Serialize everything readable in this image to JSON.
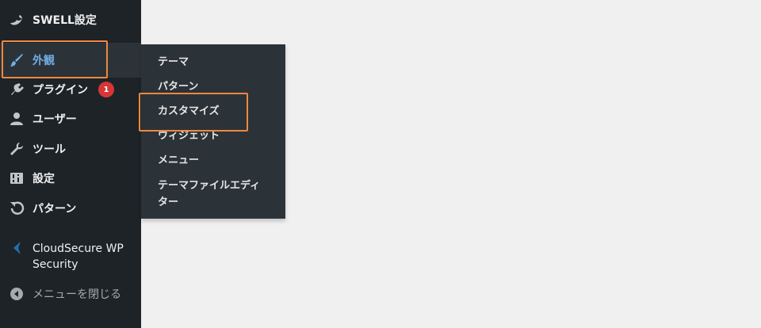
{
  "sidebar": {
    "items": [
      {
        "label": "SWELL設定",
        "icon": "swell-icon"
      },
      {
        "label": "外観",
        "icon": "paintbrush-icon"
      },
      {
        "label": "プラグイン",
        "icon": "plugin-icon",
        "badge": "1"
      },
      {
        "label": "ユーザー",
        "icon": "user-icon"
      },
      {
        "label": "ツール",
        "icon": "wrench-icon"
      },
      {
        "label": "設定",
        "icon": "settings-icon"
      },
      {
        "label": "パターン",
        "icon": "undo-icon"
      },
      {
        "label_line1": "CloudSecure WP",
        "label_line2": "Security",
        "icon": "cloudsecure-icon"
      },
      {
        "label": "メニューを閉じる",
        "icon": "collapse-icon"
      }
    ]
  },
  "submenu": {
    "items": [
      {
        "label": "テーマ"
      },
      {
        "label": "パターン"
      },
      {
        "label": "カスタマイズ"
      },
      {
        "label": "ウィジェット"
      },
      {
        "label": "メニュー"
      },
      {
        "label_line1": "テーマファイルエディ",
        "label_line2": "ター"
      }
    ]
  },
  "colors": {
    "sidebar_bg": "#1d2327",
    "submenu_bg": "#2c3338",
    "active_text": "#72aee6",
    "highlight": "#f0883e",
    "badge": "#d63638"
  }
}
